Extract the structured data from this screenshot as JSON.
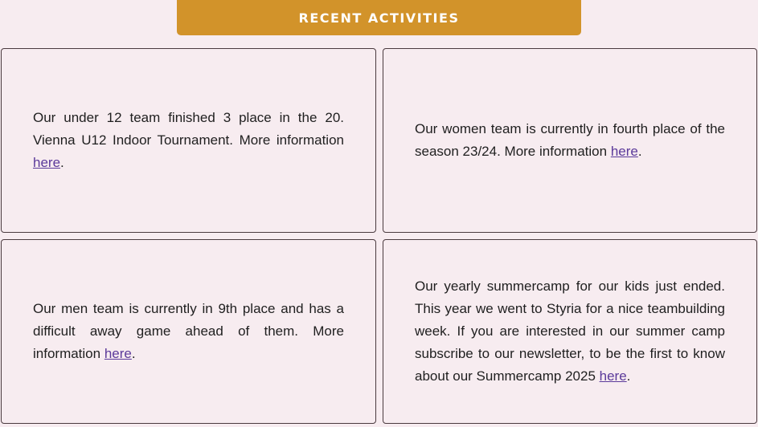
{
  "header": {
    "title": "RECENT ACTIVITIES"
  },
  "cards": [
    {
      "text": "Our under 12 team finished 3 place in the 20. Vienna U12 Indoor Tournament. More information ",
      "link_label": "here",
      "suffix": "."
    },
    {
      "text": "Our women team is currently in fourth place of the season 23/24. More information ",
      "link_label": "here",
      "suffix": "."
    },
    {
      "text": "Our men team is currently in 9th place and has a difficult away game ahead of them. More information ",
      "link_label": "here",
      "suffix": "."
    },
    {
      "text": "Our yearly summercamp for our kids just ended. This year we went to Styria for a nice teambuilding week. If you are interested in our summer camp subscribe to our newsletter, to be the first to know about our Summercamp 2025 ",
      "link_label": "here",
      "suffix": "."
    }
  ],
  "colors": {
    "background": "#f7ecf0",
    "header_bar": "#d2932a",
    "header_text": "#ffffff",
    "link": "#5b3a9a",
    "card_border": "#4a3a3f"
  }
}
